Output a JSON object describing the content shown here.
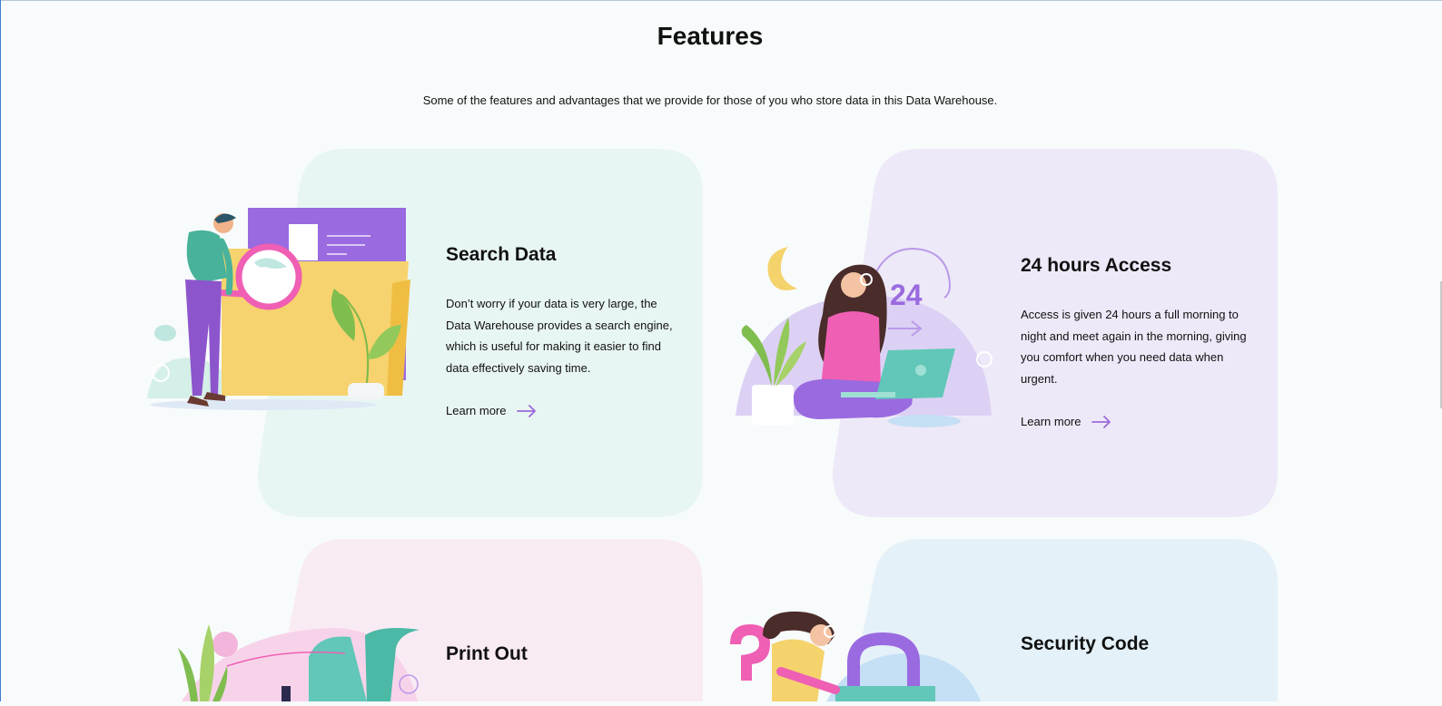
{
  "page": {
    "title": "Features",
    "subtitle": "Some of the features and advantages that we provide for those of you who store data in this Data Warehouse."
  },
  "colors": {
    "card_green": "#e8f6f3",
    "card_purple": "#eee9f8",
    "card_pink": "#f9ebf3",
    "card_blue": "#e4f1f8",
    "accent_purple": "#9b6ad8"
  },
  "features": [
    {
      "title": "Search Data",
      "description": "Don’t worry if your data is very large, the Data Warehouse provides a search engine, which is useful for making it easier to find data effectively saving time.",
      "link_label": "Learn more",
      "illustration": "man-with-magnifier-and-folder",
      "icon": "arrow-right-icon"
    },
    {
      "title": "24 hours Access",
      "description": "Access is given 24 hours a full morning to night and meet again in the morning, giving you comfort when you need data when urgent.",
      "link_label": "Learn more",
      "illustration": "woman-with-laptop-24",
      "icon": "arrow-right-icon",
      "badge": "24"
    },
    {
      "title": "Print Out",
      "illustration": "printer-with-paper"
    },
    {
      "title": "Security Code",
      "illustration": "woman-with-padlock"
    }
  ]
}
